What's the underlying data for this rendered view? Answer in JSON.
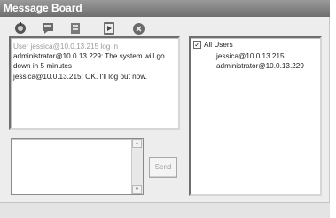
{
  "window": {
    "title": "Message Board"
  },
  "toolbar": {
    "buttons": [
      {
        "icon": "connect-icon"
      },
      {
        "icon": "chat-icon"
      },
      {
        "icon": "users-icon"
      },
      {
        "icon": "logout-icon"
      },
      {
        "icon": "close-icon"
      }
    ]
  },
  "messages": [
    {
      "text": "User jessica@10.0.13.215 log in",
      "kind": "system"
    },
    {
      "text": "administrator@10.0.13.229: The system will go",
      "kind": "chat"
    },
    {
      "text": "down in 5 minutes",
      "kind": "chat"
    },
    {
      "text": " jessica@10.0.13.215: OK. I'll log out now.",
      "kind": "chat"
    }
  ],
  "compose": {
    "text": "",
    "send_label": "Send"
  },
  "users": {
    "group_label": "All Users",
    "group_checked": true,
    "list": [
      "jessica@10.0.13.215",
      "administrator@10.0.13.229"
    ]
  }
}
